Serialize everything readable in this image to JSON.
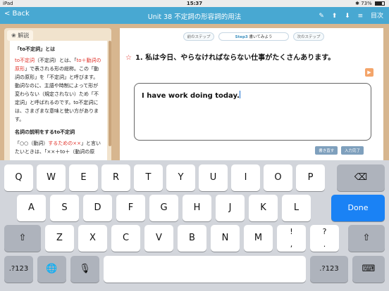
{
  "status_bar": {
    "carrier": "iPad",
    "time": "15:37",
    "battery": "73%",
    "battery_level": 0.73
  },
  "nav": {
    "back_label": "< Back",
    "title": "Unit 38  不定詞の形容詞的用法",
    "toc_label": "目次"
  },
  "explanation": {
    "tab_label": "解説",
    "heading": "「to不定詞」とは",
    "p1_red1": "to不定詞",
    "p1_text1": "（不定詞）とは、「",
    "p1_red2": "to＋動詞の原形",
    "p1_text2": "」で表される形の総称。この「動詞の原形」を「不定詞」と呼びます。動詞なのに、主語や時制によって形が変わらない（規定されない）ため「不定詞」と呼ばれるのです。to不定詞には、さまざまな意味と使い方があります。",
    "heading2": "名詞の説明をするto不定詞",
    "p2_text1": "「○○（動詞）",
    "p2_red": "するための××",
    "p2_text2": "」と言いたいときは、「××＋to＋（動詞の原"
  },
  "steps": {
    "prev": "前のステップ",
    "current_step": "Step3",
    "current_label": "書いてみよう",
    "next": "次のステップ"
  },
  "question": {
    "text": "1. 私は今日、やらなければならない仕事がたくさんあります。"
  },
  "answer": {
    "value": "I have work doing today."
  },
  "buttons": {
    "rewrite": "書き直す",
    "complete": "入力完了"
  },
  "keyboard": {
    "row1": [
      "Q",
      "W",
      "E",
      "R",
      "T",
      "Y",
      "U",
      "I",
      "O",
      "P"
    ],
    "row2": [
      "A",
      "S",
      "D",
      "F",
      "G",
      "H",
      "J",
      "K",
      "L"
    ],
    "row3": [
      "Z",
      "X",
      "C",
      "V",
      "B",
      "N",
      "M"
    ],
    "row3_punct1_top": "!",
    "row3_punct1_bottom": ",",
    "row3_punct2_top": "?",
    "row3_punct2_bottom": ".",
    "numbers_left": ".?123",
    "numbers_right": ".?123",
    "done": "Done",
    "backspace": "⌫",
    "shift": "⇧",
    "globe": "🌐",
    "mic": "🎙",
    "hide_keyboard": "⌨"
  }
}
